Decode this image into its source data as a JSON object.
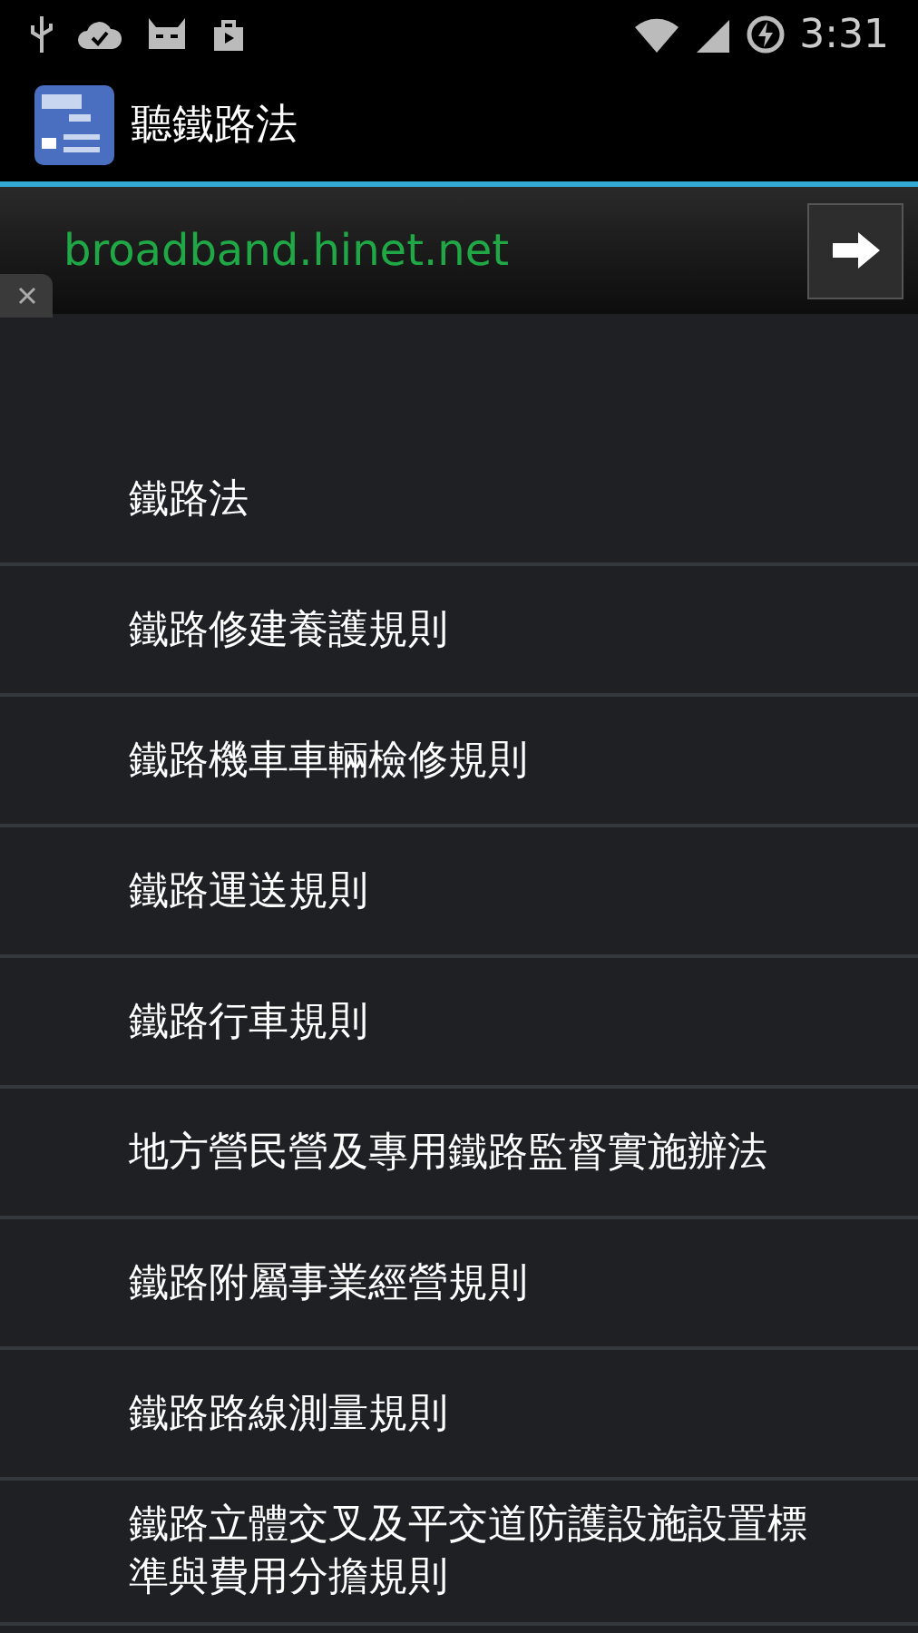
{
  "status_bar": {
    "time": "3:31"
  },
  "action_bar": {
    "title": "聽鐵路法"
  },
  "ad_banner": {
    "text": "broadband.hinet.net"
  },
  "list": [
    {
      "label": "鐵路法"
    },
    {
      "label": "鐵路修建養護規則"
    },
    {
      "label": "鐵路機車車輛檢修規則"
    },
    {
      "label": "鐵路運送規則"
    },
    {
      "label": "鐵路行車規則"
    },
    {
      "label": "地方營民營及專用鐵路監督實施辦法"
    },
    {
      "label": "鐵路附屬事業經營規則"
    },
    {
      "label": "鐵路路線測量規則"
    },
    {
      "label": "鐵路立體交叉及平交道防護設施設置標準與費用分擔規則"
    }
  ]
}
